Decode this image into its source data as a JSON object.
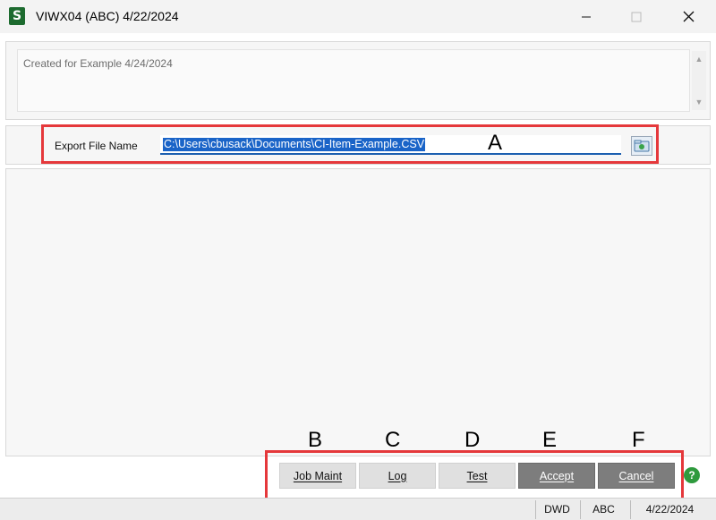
{
  "window": {
    "title": "VIWX04 (ABC) 4/22/2024",
    "app_icon_glyph": "S",
    "minimize_icon": "minimize-icon",
    "maximize_icon": "maximize-icon",
    "close_icon": "close-icon"
  },
  "notes": {
    "text": "Created for Example 4/24/2024",
    "scroll_up": "▲",
    "scroll_down": "▼"
  },
  "export": {
    "label": "Export File Name",
    "value": "C:\\Users\\cbusack\\Documents\\CI-Item-Example.CSV",
    "browse_icon": "folder-icon"
  },
  "annotations": {
    "a": "A",
    "b": "B",
    "c": "C",
    "d": "D",
    "e": "E",
    "f": "F"
  },
  "buttons": {
    "job_maint": "Job Maint",
    "log": "Log",
    "test": "Test",
    "accept": "Accept",
    "cancel": "Cancel",
    "help": "?"
  },
  "status": {
    "user": "DWD",
    "company": "ABC",
    "date": "4/22/2024"
  },
  "colors": {
    "annotation": "#e5383b",
    "selection": "#1a64c8",
    "help": "#2e9a3d",
    "app_icon": "#1d6b2f"
  }
}
